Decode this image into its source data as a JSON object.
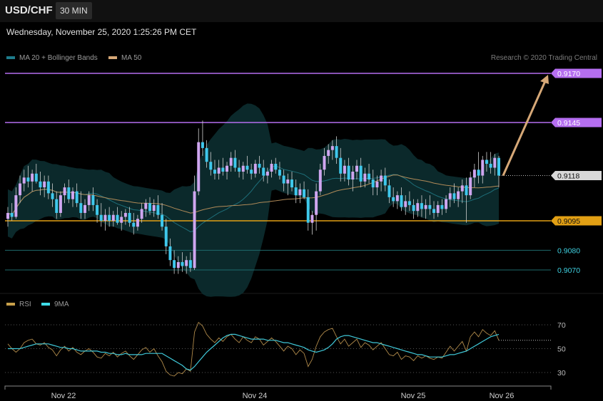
{
  "header": {
    "symbol": "USD/CHF",
    "timeframe": "30 MIN"
  },
  "timestamp": "Wednesday, November 25, 2020 1:25:26 PM CET",
  "legend": {
    "ma20": "MA 20 + Bollinger Bands",
    "ma50": "MA 50"
  },
  "credit": "Research © 2020 Trading Central",
  "rsi_legend": {
    "rsi": "RSI",
    "ma9": "9MA"
  },
  "colors": {
    "bg": "#000000",
    "up": "#cfa6f0",
    "down": "#3fc8ec",
    "band": "#0c2e30",
    "ma50": "#b08a58",
    "arrow": "#d6a877",
    "resistance": "#b56ef0",
    "support": "#e2a014",
    "pivot": "#1e6a6c"
  },
  "chart_data": [
    {
      "type": "candlestick",
      "title": "USD/CHF",
      "timeframe": "30 MIN",
      "ylim": [
        0.9057,
        0.9184
      ],
      "x_ticks": [
        "Nov 22",
        "Nov 24",
        "Nov 25",
        "Nov 26"
      ],
      "levels": [
        {
          "label": "0.9170",
          "value": 0.917,
          "kind": "resistance"
        },
        {
          "label": "0.9145",
          "value": 0.9145,
          "kind": "resistance"
        },
        {
          "label": "0.9118",
          "value": 0.9118,
          "kind": "last"
        },
        {
          "label": "0.9095",
          "value": 0.9095,
          "kind": "support"
        },
        {
          "label": "0.9080",
          "value": 0.908,
          "kind": "pivot"
        },
        {
          "label": "0.9070",
          "value": 0.907,
          "kind": "pivot"
        }
      ],
      "series": [
        {
          "name": "MA 20 + Bollinger Bands",
          "kind": "bollinger"
        },
        {
          "name": "MA 50",
          "kind": "ma"
        }
      ],
      "candles": [
        [
          0.9096,
          0.9102,
          0.9092,
          0.9099
        ],
        [
          0.9099,
          0.9104,
          0.9095,
          0.9097
        ],
        [
          0.9097,
          0.9112,
          0.9096,
          0.9108
        ],
        [
          0.9108,
          0.9118,
          0.9104,
          0.9114
        ],
        [
          0.9114,
          0.9121,
          0.911,
          0.9117
        ],
        [
          0.9117,
          0.9123,
          0.9112,
          0.9115
        ],
        [
          0.9115,
          0.9121,
          0.911,
          0.9119
        ],
        [
          0.9119,
          0.9124,
          0.9114,
          0.9115
        ],
        [
          0.9115,
          0.912,
          0.9108,
          0.9112
        ],
        [
          0.9112,
          0.9118,
          0.9107,
          0.9115
        ],
        [
          0.9115,
          0.9118,
          0.9106,
          0.9109
        ],
        [
          0.9109,
          0.9114,
          0.9102,
          0.9106
        ],
        [
          0.9106,
          0.911,
          0.9096,
          0.9099
        ],
        [
          0.9099,
          0.911,
          0.9097,
          0.9108
        ],
        [
          0.9108,
          0.9114,
          0.9104,
          0.9112
        ],
        [
          0.9112,
          0.9116,
          0.9104,
          0.9106
        ],
        [
          0.9106,
          0.9112,
          0.9102,
          0.911
        ],
        [
          0.911,
          0.9114,
          0.9102,
          0.9104
        ],
        [
          0.9104,
          0.911,
          0.9096,
          0.9099
        ],
        [
          0.9099,
          0.9106,
          0.9096,
          0.9103
        ],
        [
          0.9103,
          0.911,
          0.91,
          0.9108
        ],
        [
          0.9108,
          0.9112,
          0.91,
          0.9103
        ],
        [
          0.9103,
          0.9106,
          0.9094,
          0.9098
        ],
        [
          0.9098,
          0.9104,
          0.9092,
          0.9095
        ],
        [
          0.9095,
          0.9101,
          0.909,
          0.9098
        ],
        [
          0.9098,
          0.9102,
          0.9092,
          0.9095
        ],
        [
          0.9095,
          0.91,
          0.9092,
          0.9098
        ],
        [
          0.9098,
          0.9102,
          0.9093,
          0.9094
        ],
        [
          0.9094,
          0.91,
          0.909,
          0.9097
        ],
        [
          0.9097,
          0.9101,
          0.9093,
          0.9099
        ],
        [
          0.9099,
          0.9102,
          0.9092,
          0.9094
        ],
        [
          0.9094,
          0.9099,
          0.9088,
          0.9092
        ],
        [
          0.9092,
          0.9098,
          0.909,
          0.9096
        ],
        [
          0.9096,
          0.9104,
          0.9094,
          0.9101
        ],
        [
          0.9101,
          0.9106,
          0.9097,
          0.9104
        ],
        [
          0.9104,
          0.9107,
          0.9098,
          0.91
        ],
        [
          0.91,
          0.9106,
          0.9097,
          0.9103
        ],
        [
          0.9103,
          0.9108,
          0.9096,
          0.9098
        ],
        [
          0.9098,
          0.9104,
          0.909,
          0.9092
        ],
        [
          0.9092,
          0.9096,
          0.9078,
          0.9082
        ],
        [
          0.9082,
          0.9086,
          0.9072,
          0.9075
        ],
        [
          0.9075,
          0.908,
          0.9068,
          0.9071
        ],
        [
          0.9071,
          0.9077,
          0.9068,
          0.9074
        ],
        [
          0.9074,
          0.9079,
          0.9069,
          0.9072
        ],
        [
          0.9072,
          0.9077,
          0.9068,
          0.9075
        ],
        [
          0.9075,
          0.9079,
          0.9069,
          0.9071
        ],
        [
          0.9071,
          0.9118,
          0.907,
          0.911
        ],
        [
          0.911,
          0.9142,
          0.9108,
          0.9135
        ],
        [
          0.9135,
          0.9146,
          0.9128,
          0.9132
        ],
        [
          0.9132,
          0.9136,
          0.9122,
          0.9125
        ],
        [
          0.9125,
          0.913,
          0.9118,
          0.9121
        ],
        [
          0.9121,
          0.9126,
          0.9116,
          0.9119
        ],
        [
          0.9119,
          0.9126,
          0.9116,
          0.9122
        ],
        [
          0.9122,
          0.9127,
          0.9118,
          0.912
        ],
        [
          0.912,
          0.9125,
          0.9116,
          0.9123
        ],
        [
          0.9123,
          0.913,
          0.912,
          0.9127
        ],
        [
          0.9127,
          0.9131,
          0.912,
          0.9122
        ],
        [
          0.9122,
          0.9126,
          0.9117,
          0.912
        ],
        [
          0.912,
          0.9125,
          0.9116,
          0.9123
        ],
        [
          0.9123,
          0.9128,
          0.9119,
          0.9121
        ],
        [
          0.9121,
          0.9124,
          0.9116,
          0.9119
        ],
        [
          0.9119,
          0.9126,
          0.9117,
          0.9124
        ],
        [
          0.9124,
          0.9128,
          0.9119,
          0.9122
        ],
        [
          0.9122,
          0.9126,
          0.9115,
          0.9118
        ],
        [
          0.9118,
          0.9122,
          0.9114,
          0.912
        ],
        [
          0.912,
          0.9126,
          0.9117,
          0.9124
        ],
        [
          0.9124,
          0.9127,
          0.9119,
          0.9121
        ],
        [
          0.9121,
          0.9125,
          0.9116,
          0.9118
        ],
        [
          0.9118,
          0.9121,
          0.911,
          0.9114
        ],
        [
          0.9114,
          0.9119,
          0.9108,
          0.9116
        ],
        [
          0.9116,
          0.912,
          0.911,
          0.9112
        ],
        [
          0.9112,
          0.9116,
          0.9104,
          0.9108
        ],
        [
          0.9108,
          0.9114,
          0.9104,
          0.9111
        ],
        [
          0.9111,
          0.9115,
          0.9106,
          0.9107
        ],
        [
          0.9107,
          0.9111,
          0.909,
          0.9094
        ],
        [
          0.9094,
          0.91,
          0.9088,
          0.9098
        ],
        [
          0.9098,
          0.9114,
          0.909,
          0.911
        ],
        [
          0.911,
          0.9124,
          0.9108,
          0.9121
        ],
        [
          0.9121,
          0.9132,
          0.9118,
          0.9128
        ],
        [
          0.9128,
          0.9134,
          0.9124,
          0.9131
        ],
        [
          0.9131,
          0.9136,
          0.9126,
          0.9133
        ],
        [
          0.9133,
          0.9138,
          0.9124,
          0.9127
        ],
        [
          0.9127,
          0.9132,
          0.9115,
          0.9119
        ],
        [
          0.9119,
          0.9126,
          0.9115,
          0.9123
        ],
        [
          0.9123,
          0.9127,
          0.9113,
          0.9116
        ],
        [
          0.9116,
          0.9123,
          0.911,
          0.912
        ],
        [
          0.912,
          0.9126,
          0.9116,
          0.9123
        ],
        [
          0.9123,
          0.9127,
          0.9112,
          0.9115
        ],
        [
          0.9115,
          0.9122,
          0.9112,
          0.9119
        ],
        [
          0.9119,
          0.9124,
          0.9114,
          0.9116
        ],
        [
          0.9116,
          0.9121,
          0.9108,
          0.9112
        ],
        [
          0.9112,
          0.9118,
          0.9108,
          0.9115
        ],
        [
          0.9115,
          0.9121,
          0.911,
          0.9118
        ],
        [
          0.9118,
          0.9122,
          0.911,
          0.9113
        ],
        [
          0.9113,
          0.9116,
          0.9104,
          0.9107
        ],
        [
          0.9107,
          0.9112,
          0.9102,
          0.9105
        ],
        [
          0.9105,
          0.911,
          0.9101,
          0.9108
        ],
        [
          0.9108,
          0.9112,
          0.91,
          0.9102
        ],
        [
          0.9102,
          0.9108,
          0.9098,
          0.9105
        ],
        [
          0.9105,
          0.911,
          0.91,
          0.9103
        ],
        [
          0.9103,
          0.9106,
          0.9096,
          0.91
        ],
        [
          0.91,
          0.9106,
          0.9097,
          0.9104
        ],
        [
          0.9104,
          0.9108,
          0.9097,
          0.9101
        ],
        [
          0.9101,
          0.9106,
          0.9096,
          0.9103
        ],
        [
          0.9103,
          0.9108,
          0.9098,
          0.9101
        ],
        [
          0.9101,
          0.9105,
          0.9096,
          0.9099
        ],
        [
          0.9099,
          0.9105,
          0.9097,
          0.9103
        ],
        [
          0.9103,
          0.9106,
          0.9098,
          0.9101
        ],
        [
          0.9101,
          0.9108,
          0.9099,
          0.9106
        ],
        [
          0.9106,
          0.9112,
          0.9102,
          0.9109
        ],
        [
          0.9109,
          0.9114,
          0.9104,
          0.9106
        ],
        [
          0.9106,
          0.9112,
          0.9102,
          0.911
        ],
        [
          0.911,
          0.9116,
          0.9104,
          0.9113
        ],
        [
          0.9113,
          0.9117,
          0.9094,
          0.9108
        ],
        [
          0.9108,
          0.912,
          0.9106,
          0.9117
        ],
        [
          0.9117,
          0.9124,
          0.9112,
          0.9121
        ],
        [
          0.9121,
          0.913,
          0.9114,
          0.9118
        ],
        [
          0.9118,
          0.9128,
          0.9114,
          0.9126
        ],
        [
          0.9126,
          0.913,
          0.912,
          0.9124
        ],
        [
          0.9124,
          0.913,
          0.9119,
          0.9122
        ],
        [
          0.9122,
          0.9129,
          0.9118,
          0.9127
        ],
        [
          0.9127,
          0.9128,
          0.9112,
          0.9118
        ]
      ],
      "rsi_panel": {
        "ylim": [
          20,
          80
        ],
        "levels": [
          70,
          50,
          30
        ],
        "series": [
          {
            "name": "RSI",
            "values": [
              54,
              50,
              47,
              50,
              55,
              57,
              58,
              54,
              53,
              55,
              51,
              49,
              44,
              49,
              52,
              48,
              51,
              47,
              45,
              48,
              50,
              47,
              43,
              42,
              46,
              44,
              47,
              43,
              46,
              48,
              44,
              41,
              45,
              49,
              51,
              47,
              50,
              44,
              39,
              31,
              28,
              27,
              30,
              29,
              33,
              31,
              64,
              72,
              69,
              62,
              58,
              55,
              59,
              56,
              60,
              62,
              58,
              55,
              60,
              57,
              55,
              60,
              58,
              53,
              56,
              59,
              56,
              52,
              48,
              52,
              50,
              45,
              49,
              46,
              35,
              41,
              52,
              60,
              64,
              66,
              67,
              60,
              54,
              58,
              52,
              55,
              58,
              51,
              55,
              53,
              49,
              52,
              55,
              50,
              45,
              44,
              47,
              41,
              44,
              43,
              40,
              44,
              42,
              44,
              42,
              41,
              43,
              42,
              47,
              52,
              48,
              52,
              56,
              48,
              60,
              64,
              60,
              66,
              63,
              61,
              65,
              57
            ]
          },
          {
            "name": "9MA",
            "values": [
              50,
              50,
              50,
              50,
              51,
              52,
              53,
              54,
              54,
              54,
              54,
              53,
              52,
              51,
              51,
              50,
              50,
              49,
              48,
              48,
              48,
              48,
              48,
              47,
              47,
              46,
              46,
              45,
              45,
              46,
              45,
              45,
              45,
              45,
              46,
              46,
              46,
              46,
              46,
              44,
              42,
              40,
              38,
              36,
              33,
              32,
              35,
              39,
              43,
              47,
              50,
              53,
              56,
              59,
              61,
              62,
              62,
              61,
              60,
              59,
              58,
              58,
              58,
              58,
              57,
              57,
              57,
              56,
              55,
              55,
              54,
              53,
              52,
              51,
              49,
              48,
              47,
              48,
              49,
              51,
              54,
              58,
              60,
              61,
              61,
              60,
              59,
              58,
              57,
              56,
              55,
              55,
              54,
              53,
              52,
              51,
              50,
              49,
              48,
              47,
              46,
              45,
              45,
              44,
              43,
              43,
              43,
              43,
              44,
              45,
              45,
              46,
              47,
              48,
              50,
              52,
              54,
              56,
              58,
              60,
              61,
              62
            ]
          }
        ]
      }
    }
  ]
}
